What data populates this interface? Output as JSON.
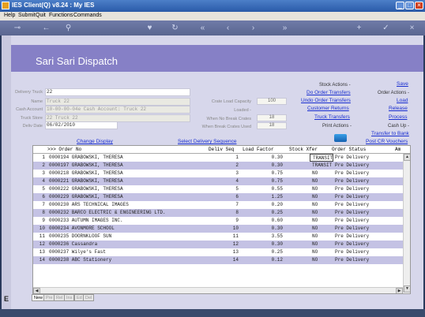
{
  "window": {
    "title": "IES Client(Q) v8.24 : My IES",
    "controls": [
      "_",
      "□",
      "×"
    ]
  },
  "menu": [
    "Help",
    "Submit",
    "Quit",
    "Functions",
    "Commands"
  ],
  "toolbar": {
    "icons": [
      "key-icon",
      "back-icon",
      "search-icon",
      "heart-icon",
      "history-icon",
      "first-icon",
      "previous-icon",
      "next-icon",
      "last-icon",
      "add-icon",
      "confirm-icon",
      "close-icon"
    ]
  },
  "page": {
    "title": "Sari Sari Dispatch"
  },
  "form": {
    "delivery_truck": {
      "label": "Delivery Truck",
      "value": "22"
    },
    "name": {
      "label": "Name",
      "value": "Truck 22"
    },
    "cash_account": {
      "label": "Cash Account",
      "value": "10-00-00-04e Cash Account: Truck 22"
    },
    "truck_store": {
      "label": "Truck Store",
      "value": "22 Truck 22"
    },
    "deliv_date": {
      "label": "Deliv Date",
      "value": "06/02/2010"
    },
    "crate_load_capacity": {
      "label": "Crate Load Capacity",
      "value": "100"
    },
    "loaded": {
      "label": "Loaded -",
      "value": ""
    },
    "when_no_break_crates": {
      "label": "When No Break Crates",
      "value": "18"
    },
    "when_break_crates_used": {
      "label": "When Break Crates Used",
      "value": "18"
    }
  },
  "links": {
    "change_display": "Change Display",
    "select_delivery_sequence": "Select Delivery Sequence"
  },
  "actions": {
    "save": "Save",
    "stock_actions_label": "Stock Actions -",
    "do_order_transfers": "Do Order Transfers",
    "undo_order_transfers": "Undo Order Transfers",
    "customer_returns": "Customer Returns",
    "truck_transfers": "Truck Transfers",
    "print_actions_label": "Print Actions -",
    "order_actions_label": "Order Actions -",
    "load": "Load",
    "release": "Release",
    "process": "Process",
    "cash_up_label": "Cash Up -",
    "transfer_to_bank": "Transfer to Bank",
    "post_cr_vouchers": "Post CR Vouchers"
  },
  "grid": {
    "headers": {
      "order_no": ">>> Order No",
      "deliv_seq": "Deliv Seq",
      "load_factor": "Load Factor",
      "stock_xfer": "Stock Xfer",
      "order_status": "Order Status",
      "am": "Am"
    },
    "rows": [
      {
        "n": "1",
        "order": "0000194 GRABOWSKI, THERESA",
        "seq": "1",
        "lf": "0.30",
        "xfer": "TRANSIT",
        "status": "Pre Delivery",
        "selected": true
      },
      {
        "n": "2",
        "order": "0000197 GRABOWSKI, THERESA",
        "seq": "2",
        "lf": "0.30",
        "xfer": "TRANSIT",
        "status": "Pre Delivery",
        "selected": false
      },
      {
        "n": "3",
        "order": "0000218 GRABOWSKI, THERESA",
        "seq": "3",
        "lf": "0.75",
        "xfer": "NO",
        "status": "Pre Delivery",
        "selected": false
      },
      {
        "n": "4",
        "order": "0000221 GRABOWSKI, THERESA",
        "seq": "4",
        "lf": "0.75",
        "xfer": "NO",
        "status": "Pre Delivery",
        "selected": false
      },
      {
        "n": "5",
        "order": "0000222 GRABOWSKI, THERESA",
        "seq": "5",
        "lf": "0.55",
        "xfer": "NO",
        "status": "Pre Delivery",
        "selected": false
      },
      {
        "n": "6",
        "order": "0000229 GRABOWSKI, THERESA",
        "seq": "6",
        "lf": "1.25",
        "xfer": "NO",
        "status": "Pre Delivery",
        "selected": false
      },
      {
        "n": "7",
        "order": "0000230 ARS TECHNICAL IMAGES",
        "seq": "7",
        "lf": "0.20",
        "xfer": "NO",
        "status": "Pre Delivery",
        "selected": false
      },
      {
        "n": "8",
        "order": "0000232 BARCO ELECTRIC & ENGINEERING LTD.",
        "seq": "8",
        "lf": "0.25",
        "xfer": "NO",
        "status": "Pre Delivery",
        "selected": false
      },
      {
        "n": "9",
        "order": "0000233 AUTUMN IMAGES INC.",
        "seq": "9",
        "lf": "0.60",
        "xfer": "NO",
        "status": "Pre Delivery",
        "selected": false
      },
      {
        "n": "10",
        "order": "0000234 AVONMORE SCHOOL",
        "seq": "10",
        "lf": "0.30",
        "xfer": "NO",
        "status": "Pre Delivery",
        "selected": false
      },
      {
        "n": "11",
        "order": "0000235 DOORNKLOOF SUN",
        "seq": "11",
        "lf": "3.55",
        "xfer": "NO",
        "status": "Pre Delivery",
        "selected": false
      },
      {
        "n": "12",
        "order": "0000236 Cassandra",
        "seq": "12",
        "lf": "0.30",
        "xfer": "NO",
        "status": "Pre Delivery",
        "selected": false
      },
      {
        "n": "13",
        "order": "0000237 Wilye's Fast",
        "seq": "13",
        "lf": "0.25",
        "xfer": "NO",
        "status": "Pre Delivery",
        "selected": false
      },
      {
        "n": "14",
        "order": "0000238 ABC Stationery",
        "seq": "14",
        "lf": "0.12",
        "xfer": "NO",
        "status": "Pre Delivery",
        "selected": false
      }
    ]
  },
  "tabs": [
    "New",
    "Pre",
    "Rel",
    "Ins",
    "Ed",
    "Del"
  ],
  "colors": {
    "header_band": "#8680c6",
    "row_alt": "#c4c2e4",
    "link": "#1a2fd0",
    "panel": "#d7d7eb"
  }
}
